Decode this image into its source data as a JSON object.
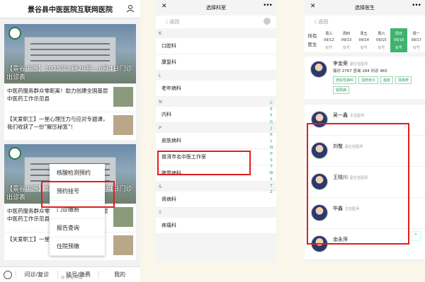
{
  "panel1": {
    "title": "景谷县中医医院互联网医院",
    "card1": {
      "hero_caption": "【景谷中医】2025年5月29日—6月4日门诊出诊表",
      "news": [
        "中医药服务群众零距离！助力创建全国基层中医药工作示范县",
        "【关爱职工】一堂心理压力与应对专题课，我们收获了一份\"解压秘笈\"！"
      ]
    },
    "card2": {
      "hero_caption": "【景谷中医】2025年5月29日—6月4日门诊出诊表",
      "news": [
        "中医药服务群众零距离！助力创建全国基层中医药工作示范县",
        "【关爱职工】一堂心"
      ]
    },
    "popup_menu": [
      "核酸检测预约",
      "预约挂号",
      "门诊缴费",
      "报告查询",
      "住院预缴"
    ],
    "bottom_bar": [
      "问诊/复诊",
      "挂号/缴费",
      "我的"
    ]
  },
  "panel2": {
    "title": "选择科室",
    "back": "返回",
    "groups": [
      {
        "letter": "K",
        "items": [
          "口腔科",
          "康复科"
        ]
      },
      {
        "letter": "L",
        "items": [
          "老年病科"
        ]
      },
      {
        "letter": "N",
        "items": [
          "内科"
        ]
      },
      {
        "letter": "P",
        "items": [
          "皮肤病科",
          "普洱市名中医工作室",
          "脾胃病科"
        ]
      },
      {
        "letter": "S",
        "items": [
          "肾病科"
        ]
      },
      {
        "letter": "T",
        "items": [
          "疼痛科"
        ]
      }
    ],
    "alphabet": [
      "C",
      "E",
      "F",
      "G",
      "J",
      "K",
      "L",
      "N",
      "P",
      "S",
      "T",
      "W",
      "X",
      "Y",
      "Z"
    ]
  },
  "panel3": {
    "title": "选择医生",
    "back": "返回",
    "dates_label_top": "所有",
    "dates_label_bottom": "医生",
    "dates": [
      {
        "day": "周三",
        "date": "09/12",
        "status": "有号"
      },
      {
        "day": "周四",
        "date": "09/13",
        "status": "有号"
      },
      {
        "day": "周五",
        "date": "09/14",
        "status": "有号"
      },
      {
        "day": "周六",
        "date": "09/15",
        "status": "有号"
      },
      {
        "day": "周日",
        "date": "09/16",
        "status": "有号"
      },
      {
        "day": "周一",
        "date": "09/17",
        "status": "有号"
      }
    ],
    "featured": {
      "name": "李金荣",
      "title": "副主任医师",
      "stats": "接诊 2767  咨询 284  问诊 465",
      "tags": [
        "皮肤性病科",
        "湿疹皮炎",
        "痤疮",
        "荨麻疹",
        "银屑病"
      ]
    },
    "doctors": [
      {
        "name": "吴一鑫",
        "title": "主任医师"
      },
      {
        "name": "刘敬",
        "title": "副主任医师"
      },
      {
        "name": "王晓川",
        "title": "副主任医师"
      },
      {
        "name": "毕鑫",
        "title": "主任医师"
      },
      {
        "name": "余永萍",
        "title": ""
      }
    ]
  },
  "watermark": "景谷中医"
}
